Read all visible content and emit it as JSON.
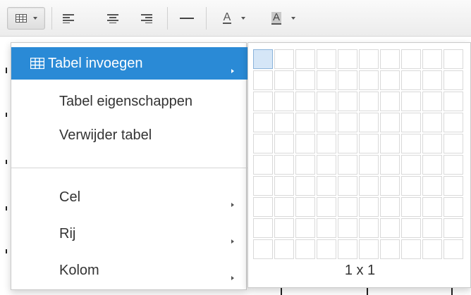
{
  "toolbar": {
    "buttons": [
      {
        "name": "table-button",
        "icon": "table-icon",
        "has_dropdown": true
      },
      {
        "name": "align-left-button",
        "icon": "align-left-icon"
      },
      {
        "name": "align-center-button",
        "icon": "align-center-icon"
      },
      {
        "name": "align-right-button",
        "icon": "align-right-icon"
      },
      {
        "name": "horizontal-rule-button",
        "icon": "horizontal-rule-icon"
      },
      {
        "name": "text-color-button",
        "icon": "text-color-icon",
        "glyph": "A",
        "has_dropdown": true
      },
      {
        "name": "background-color-button",
        "icon": "background-color-icon",
        "glyph": "A",
        "has_dropdown": true
      }
    ]
  },
  "menu": {
    "items": [
      {
        "label": "Tabel invoegen",
        "icon": "table-icon",
        "has_submenu": true,
        "selected": true
      },
      {
        "label": "Tabel eigenschappen",
        "has_submenu": false
      },
      {
        "label": "Verwijder tabel",
        "has_submenu": false
      },
      {
        "label": "Cel",
        "has_submenu": true
      },
      {
        "label": "Rij",
        "has_submenu": true
      },
      {
        "label": "Kolom",
        "has_submenu": true
      }
    ]
  },
  "grid_picker": {
    "columns": 10,
    "rows": 10,
    "highlighted_cols": 1,
    "highlighted_rows": 1,
    "size_label": "1 x 1"
  },
  "colors": {
    "accent": "#2a8ad6",
    "highlight_cell": "#d5e6f7"
  }
}
